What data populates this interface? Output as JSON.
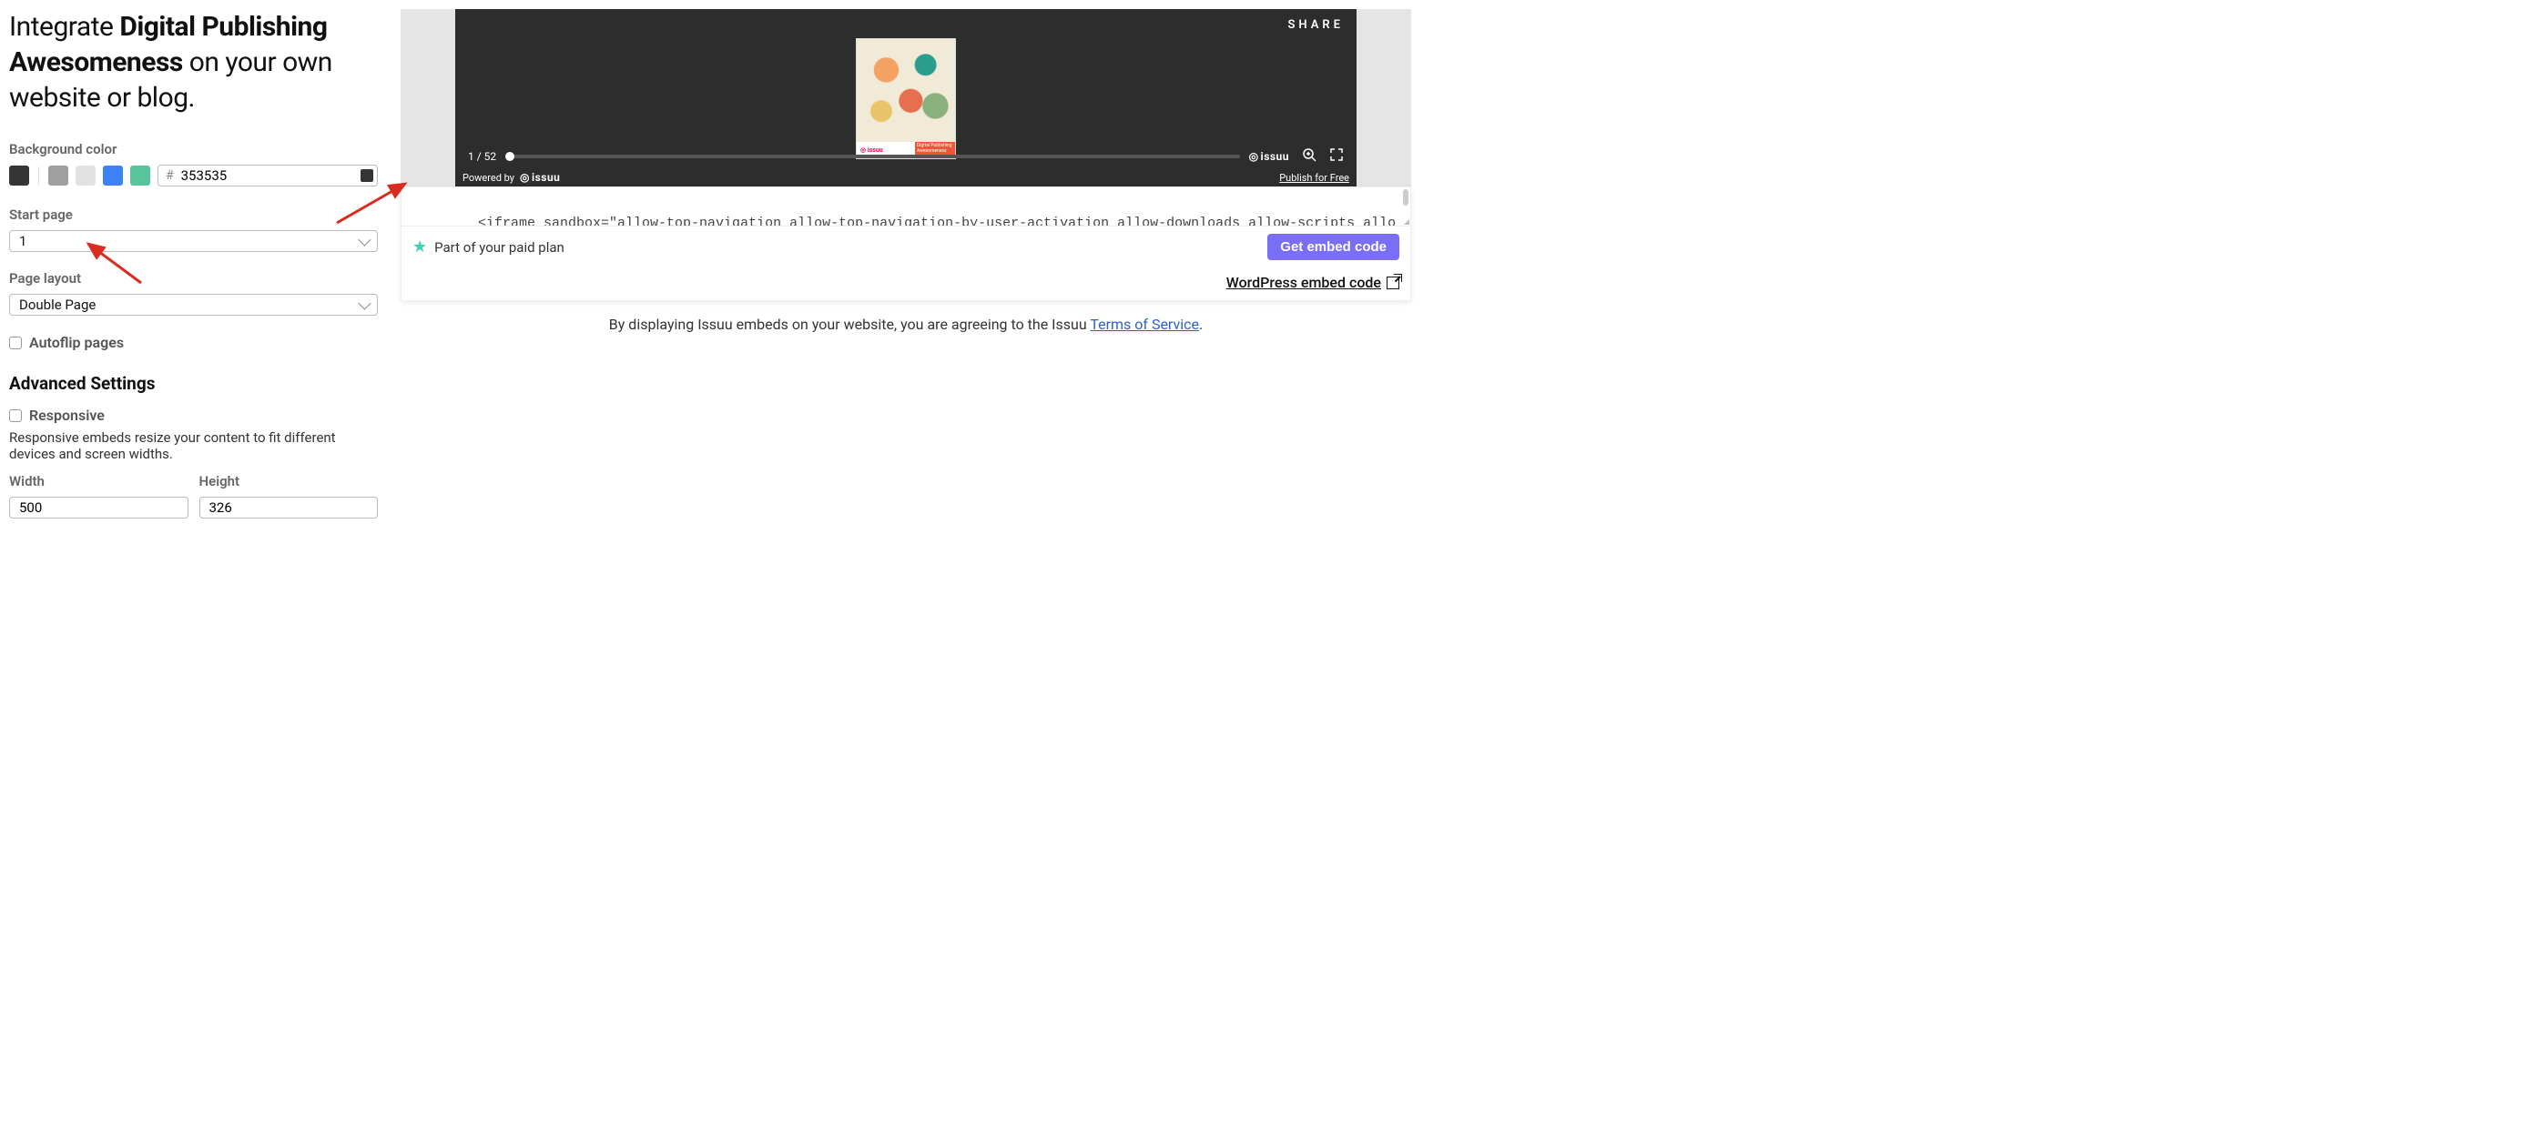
{
  "headline_prefix": "Integrate ",
  "headline_bold": "Digital Publishing Awesomeness",
  "headline_suffix": " on your own website or blog.",
  "bg_color_label": "Background color",
  "hex_value": "353535",
  "hash_symbol": "#",
  "start_page_label": "Start page",
  "start_page_value": "1",
  "page_layout_label": "Page layout",
  "page_layout_value": "Double Page",
  "autoflip_label": "Autoflip pages",
  "advanced_title": "Advanced Settings",
  "responsive_label": "Responsive",
  "responsive_help": "Responsive embeds resize your content to fit different devices and screen widths.",
  "width_label": "Width",
  "width_value": "500",
  "height_label": "Height",
  "height_value": "326",
  "preview": {
    "share": "SHARE",
    "page_indicator": "1 / 52",
    "brand": "issuu",
    "powered_by": "Powered by",
    "publish_free": "Publish for Free",
    "cover_brand": "◎ issuu",
    "cover_tag": "Digital Publishing Awesomeness"
  },
  "embed_code": "<iframe sandbox=\"allow-top-navigation allow-top-navigation-by-user-activation allow-downloads allow-scripts allow-same-origin allow-popups allow-modals allow-popups-to-escape-sandbox\" allowfullscreen=\"true\"",
  "plan_text": "Part of your paid plan",
  "get_embed_label": "Get embed code",
  "wp_label": "WordPress embed code",
  "tos_prefix": "By displaying Issuu embeds on your website, you are agreeing to the Issuu ",
  "tos_link": "Terms of Service",
  "tos_suffix": "."
}
